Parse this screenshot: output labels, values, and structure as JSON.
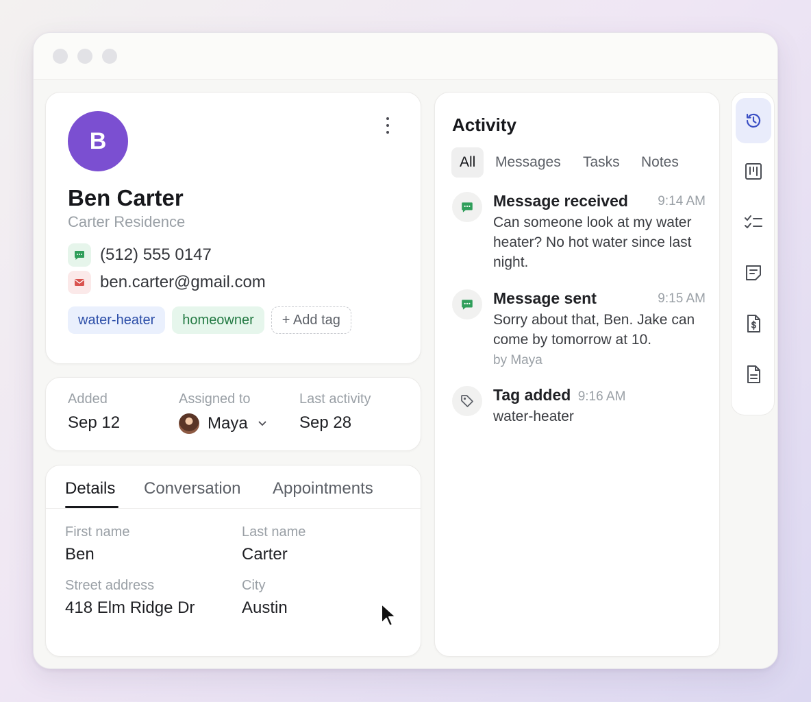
{
  "contact": {
    "initial": "B",
    "name": "Ben Carter",
    "company": "Carter Residence",
    "phone": "(512) 555 0147",
    "email": "ben.carter@gmail.com",
    "tags": [
      "water-heater",
      "homeowner"
    ],
    "add_tag_label": "+ Add tag"
  },
  "meta": {
    "added_label": "Added",
    "added_value": "Sep 12",
    "assigned_label": "Assigned to",
    "assigned_value": "Maya",
    "last_activity_label": "Last activity",
    "last_activity_value": "Sep 28"
  },
  "details": {
    "tabs": [
      "Details",
      "Conversation",
      "Appointments"
    ],
    "active_tab": "Details",
    "fields": [
      {
        "label": "First name",
        "value": "Ben"
      },
      {
        "label": "Last name",
        "value": "Carter"
      },
      {
        "label": "Street address",
        "value": "418 Elm Ridge Dr"
      },
      {
        "label": "City",
        "value": "Austin"
      }
    ]
  },
  "activity": {
    "title": "Activity",
    "filters": [
      "All",
      "Messages",
      "Tasks",
      "Notes"
    ],
    "active_filter": "All",
    "events": [
      {
        "icon": "message-icon",
        "title": "Message received",
        "time": "9:14 AM",
        "body": "Can someone look at my water heater? No hot water since last night.",
        "by": ""
      },
      {
        "icon": "message-icon",
        "title": "Message sent",
        "time": "9:15 AM",
        "body": "Sorry about that, Ben. Jake can come by tomorrow at 10.",
        "by": "by Maya"
      },
      {
        "icon": "tag-icon",
        "title": "Tag added",
        "time": "9:16 AM",
        "body": "water-heater",
        "by": ""
      }
    ]
  },
  "rail": {
    "items": [
      "history-icon",
      "board-icon",
      "checklist-icon",
      "note-icon",
      "invoice-icon",
      "document-icon"
    ],
    "active": "history-icon"
  },
  "colors": {
    "accent": "#3b4fc4",
    "avatar": "#7b4fd1",
    "sms_green": "#2f9e5a",
    "email_red": "#d9534f"
  }
}
